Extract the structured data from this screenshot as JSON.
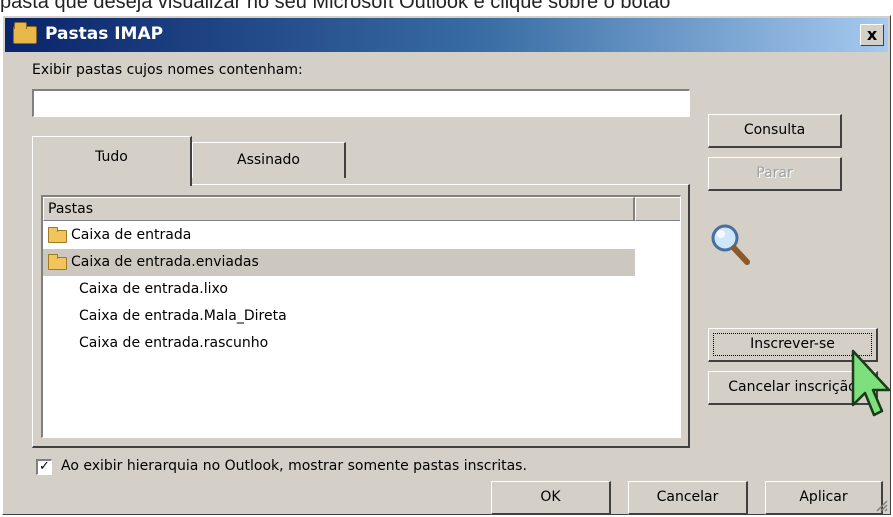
{
  "caption": "pasta que deseja visualizar no seu Microsoft Outlook e clique sobre o botão",
  "window": {
    "title": "Pastas IMAP",
    "close_label": "x"
  },
  "filter": {
    "label": "Exibir pastas cujos nomes contenham:",
    "value": ""
  },
  "tabs": [
    {
      "label": "Tudo"
    },
    {
      "label": "Assinado"
    }
  ],
  "list": {
    "column_header": "Pastas",
    "rows": [
      {
        "label": "Caixa de entrada",
        "icon": "folder-icon",
        "selected": false
      },
      {
        "label": "Caixa de entrada.enviadas",
        "icon": "folder-icon",
        "selected": true
      },
      {
        "label": "Caixa de entrada.lixo",
        "icon": "",
        "selected": false
      },
      {
        "label": "Caixa de entrada.Mala_Direta",
        "icon": "",
        "selected": false
      },
      {
        "label": "Caixa de entrada.rascunho",
        "icon": "",
        "selected": false
      }
    ]
  },
  "side_buttons": {
    "consulta": "Consulta",
    "parar": "Parar",
    "inscrever": "Inscrever-se",
    "cancelar_inscricao": "Cancelar inscrição"
  },
  "checkbox": {
    "checked": true,
    "label": "Ao exibir hierarquia no Outlook, mostrar somente pastas inscritas."
  },
  "footer_buttons": {
    "ok": "OK",
    "cancelar": "Cancelar",
    "aplicar": "Aplicar"
  },
  "colors": {
    "titlebar_start": "#0a246a",
    "titlebar_end": "#a6caf0",
    "dialog_bg": "#d4d0c8",
    "selected_row": "#ccc8bf",
    "folder": "#f2c45e",
    "cursor": "#7de07d"
  }
}
